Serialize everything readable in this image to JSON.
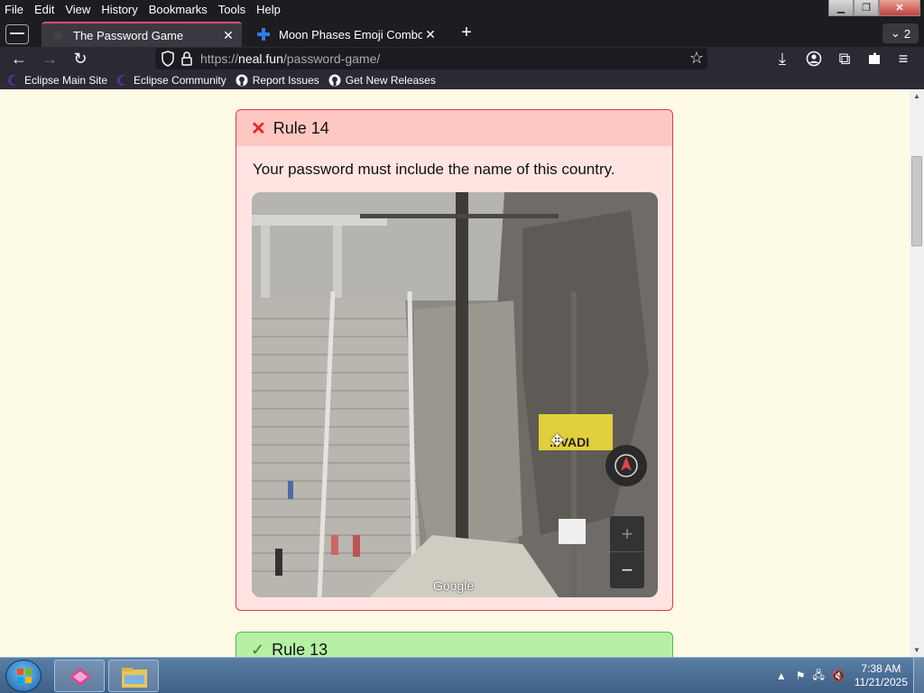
{
  "menubar": {
    "items": [
      "File",
      "Edit",
      "View",
      "History",
      "Bookmarks",
      "Tools",
      "Help"
    ]
  },
  "tabs": [
    {
      "label": "The Password Game",
      "active": true
    },
    {
      "label": "Moon Phases Emoji Combos | ",
      "active": false
    }
  ],
  "tab_count": "2",
  "nav": {
    "url_scheme": "https://",
    "url_host": "neal.fun",
    "url_path": "/password-game/"
  },
  "bookmarks": [
    {
      "label": "Eclipse Main Site",
      "icon": "eclipse-icon"
    },
    {
      "label": "Eclipse Community",
      "icon": "eclipse-icon"
    },
    {
      "label": "Report Issues",
      "icon": "github-icon"
    },
    {
      "label": "Get New Releases",
      "icon": "github-icon"
    }
  ],
  "rule14": {
    "title": "Rule 14",
    "text": "Your password must include the name of this country.",
    "map_brand": "Google",
    "sign_text": "...VADI"
  },
  "rule13": {
    "title": "Rule 13"
  },
  "taskbar": {
    "time": "7:38 AM",
    "date": "11/21/2025"
  },
  "colors": {
    "rule_fail_border": "#e23b3b",
    "rule_fail_bg": "#ffe4e1",
    "rule_pass_bg": "#b6f0a4",
    "page_bg": "#fdfbe6",
    "active_tab_accent": "#e0478d"
  }
}
